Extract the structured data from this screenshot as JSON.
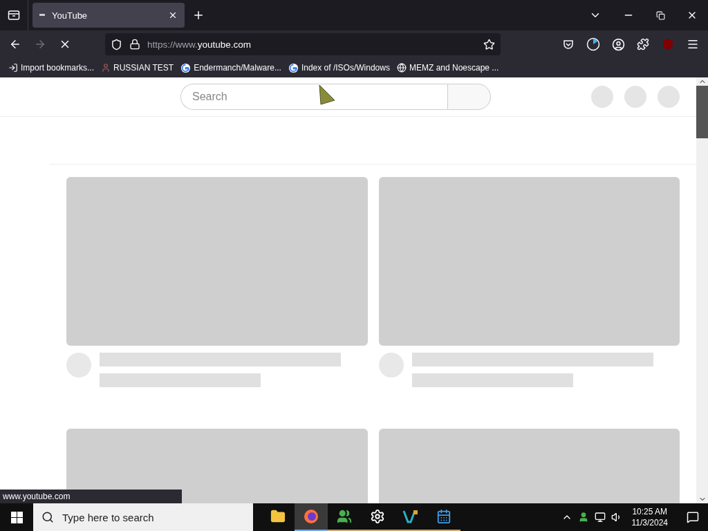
{
  "tabs": [
    {
      "title": "YouTube",
      "selected": true
    }
  ],
  "address": {
    "url_prefix": "https://www.",
    "url_host": "youtube.com"
  },
  "bookmarks": [
    {
      "label": "Import bookmarks...",
      "kind": "import"
    },
    {
      "label": "RUSSIAN TEST",
      "kind": "person"
    },
    {
      "label": "Endermanch/Malware...",
      "kind": "google"
    },
    {
      "label": "Index of /ISOs/Windows",
      "kind": "google"
    },
    {
      "label": "MEMZ and Noescape ...",
      "kind": "globe"
    }
  ],
  "page": {
    "search": {
      "placeholder": "Search"
    }
  },
  "status_url": "www.youtube.com",
  "taskbar": {
    "search_placeholder": "Type here to search",
    "apps": [
      {
        "kind": "explorer",
        "active": false,
        "running": false
      },
      {
        "kind": "firefox",
        "active": true,
        "running": false
      },
      {
        "kind": "people",
        "active": false,
        "running": true
      },
      {
        "kind": "settings",
        "active": false,
        "running": true
      },
      {
        "kind": "vs",
        "active": false,
        "running": true
      },
      {
        "kind": "calendar",
        "active": false,
        "running": true
      }
    ],
    "time": "10:25 AM",
    "date": "11/3/2024"
  }
}
